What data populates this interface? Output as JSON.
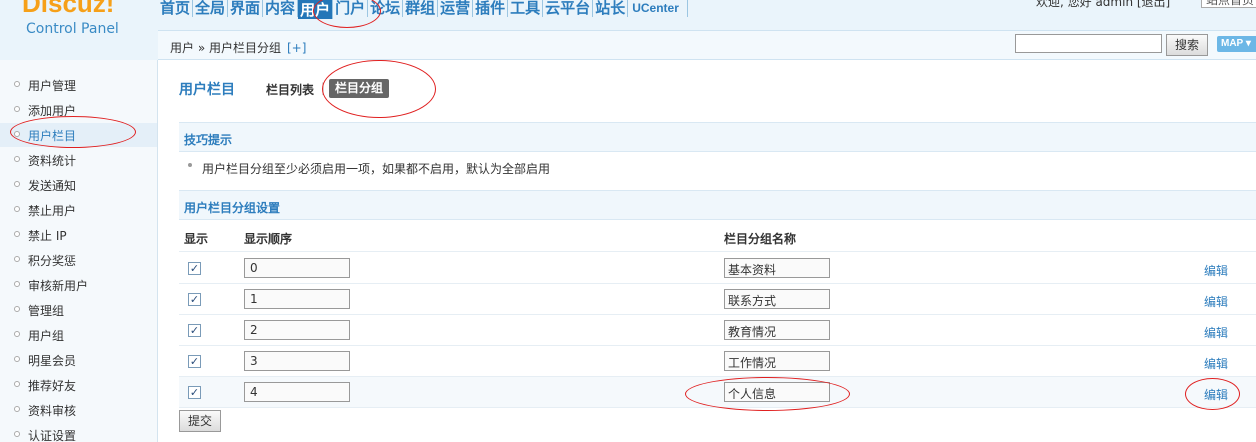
{
  "logo": {
    "brand": "Discuz!",
    "subtitle": "Control Panel"
  },
  "topnav": [
    {
      "id": "home",
      "label": "首页"
    },
    {
      "id": "global",
      "label": "全局"
    },
    {
      "id": "interface",
      "label": "界面"
    },
    {
      "id": "content",
      "label": "内容"
    },
    {
      "id": "user",
      "label": "用户",
      "active": true
    },
    {
      "id": "portal",
      "label": "门户"
    },
    {
      "id": "forum",
      "label": "论坛"
    },
    {
      "id": "group",
      "label": "群组"
    },
    {
      "id": "ops",
      "label": "运营"
    },
    {
      "id": "plugin",
      "label": "插件"
    },
    {
      "id": "tools",
      "label": "工具"
    },
    {
      "id": "cloud",
      "label": "云平台"
    },
    {
      "id": "admin",
      "label": "站长"
    },
    {
      "id": "ucenter",
      "label": "UCenter"
    }
  ],
  "topright": {
    "welcome": "欢迎, 您好 admin",
    "logout": "[退出]",
    "site_button": "站点首页"
  },
  "breadcrumb": {
    "path": "用户 » 用户栏目分组",
    "plus": "[+]"
  },
  "search": {
    "button": "搜索",
    "map": "MAP"
  },
  "sidebar": {
    "items": [
      {
        "label": "用户管理"
      },
      {
        "label": "添加用户"
      },
      {
        "label": "用户栏目",
        "active": true
      },
      {
        "label": "资料统计"
      },
      {
        "label": "发送通知"
      },
      {
        "label": "禁止用户"
      },
      {
        "label": "禁止 IP"
      },
      {
        "label": "积分奖惩"
      },
      {
        "label": "审核新用户"
      },
      {
        "label": "管理组"
      },
      {
        "label": "用户组"
      },
      {
        "label": "明星会员"
      },
      {
        "label": "推荐好友"
      },
      {
        "label": "资料审核"
      },
      {
        "label": "认证设置"
      }
    ]
  },
  "main": {
    "title": "用户栏目",
    "tabs": [
      {
        "label": "栏目列表"
      },
      {
        "label": "栏目分组",
        "active": true
      }
    ],
    "tips_title": "技巧提示",
    "tips_text": "用户栏目分组至少必须启用一项，如果都不启用，默认为全部启用",
    "section_title": "用户栏目分组设置",
    "columns": {
      "show": "显示",
      "order": "显示顺序",
      "name": "栏目分组名称"
    },
    "rows": [
      {
        "checked": true,
        "order": "0",
        "name": "基本资料",
        "action": "编辑"
      },
      {
        "checked": true,
        "order": "1",
        "name": "联系方式",
        "action": "编辑"
      },
      {
        "checked": true,
        "order": "2",
        "name": "教育情况",
        "action": "编辑"
      },
      {
        "checked": true,
        "order": "3",
        "name": "工作情况",
        "action": "编辑"
      },
      {
        "checked": true,
        "order": "4",
        "name": "个人信息",
        "action": "编辑"
      }
    ],
    "submit": "提交"
  },
  "colors": {
    "accent": "#2d7dbd",
    "logo_orange": "#f6a019",
    "annotation_red": "#e02020"
  }
}
